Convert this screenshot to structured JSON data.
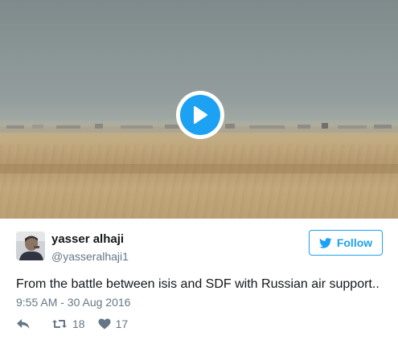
{
  "tweet": {
    "author_name": "yasser alhaji",
    "author_handle": "@yasseralhaji1",
    "follow_label": "Follow",
    "text": "From the battle between isis and SDF with Russian air support..",
    "timestamp": "9:55 AM - 30 Aug 2016",
    "retweet_count": "18",
    "like_count": "17"
  },
  "media": {
    "type": "video",
    "play_icon": "play-icon"
  },
  "colors": {
    "accent": "#1da1f2",
    "secondary_text": "#657786",
    "primary_text": "#14171a"
  }
}
